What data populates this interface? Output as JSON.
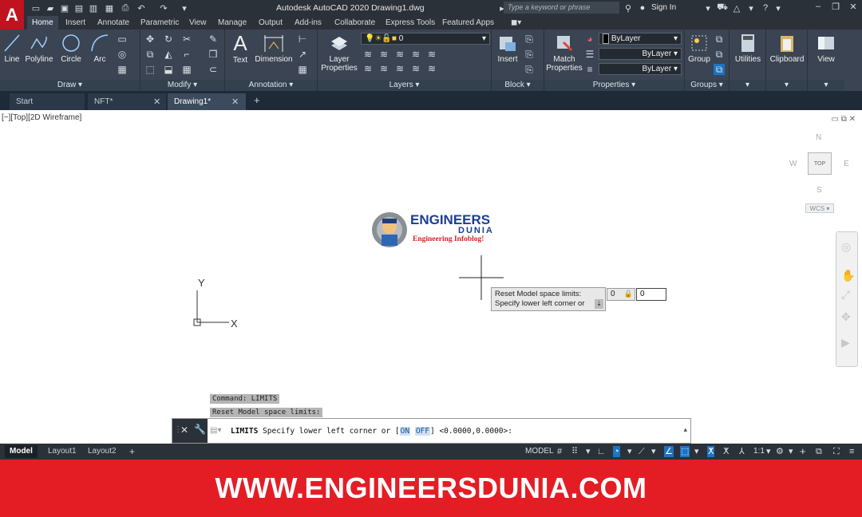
{
  "app": {
    "logo_letter": "A",
    "title": "Autodesk AutoCAD 2020    Drawing1.dwg",
    "search_placeholder": "Type a keyword or phrase",
    "sign_in": "Sign In"
  },
  "ribbon_tabs": [
    "Home",
    "Insert",
    "Annotate",
    "Parametric",
    "View",
    "Manage",
    "Output",
    "Add-ins",
    "Collaborate",
    "Express Tools",
    "Featured Apps"
  ],
  "ribbon": {
    "draw": {
      "title": "Draw",
      "line": "Line",
      "polyline": "Polyline",
      "circle": "Circle",
      "arc": "Arc"
    },
    "modify": {
      "title": "Modify"
    },
    "annotation": {
      "title": "Annotation",
      "text": "Text",
      "dimension": "Dimension"
    },
    "layers": {
      "title": "Layers",
      "layer_properties_1": "Layer",
      "layer_properties_2": "Properties",
      "current_layer": "0"
    },
    "block": {
      "title": "Block",
      "insert": "Insert"
    },
    "properties": {
      "title": "Properties",
      "match_1": "Match",
      "match_2": "Properties",
      "color": "ByLayer",
      "linetype": "ByLayer",
      "lineweight": "ByLayer"
    },
    "groups": {
      "title": "Groups",
      "group": "Group"
    },
    "utilities": "Utilities",
    "clipboard": "Clipboard",
    "view": "View"
  },
  "doc_tabs": {
    "start": "Start",
    "nft": "NFT*",
    "drawing": "Drawing1*"
  },
  "viewport": {
    "label": "[−][Top][2D Wireframe]",
    "cube_n": "N",
    "cube_s": "S",
    "cube_e": "E",
    "cube_w": "W",
    "cube_top": "TOP",
    "wcs": "WCS",
    "ucs_x": "X",
    "ucs_y": "Y"
  },
  "logo": {
    "line1": "ENGINEERS",
    "line2": "DUNIA",
    "tagline": "Engineering Infoblog!"
  },
  "prompt": {
    "line1": "Reset Model space limits:",
    "line2": "Specify lower left corner or",
    "input_x": "0",
    "input_y": "0"
  },
  "command_history": [
    "Command: LIMITS",
    "Reset Model space limits:"
  ],
  "command_line": {
    "keyword": "LIMITS",
    "text_a": " Specify lower left corner or [",
    "opt_on": "ON",
    "opt_off": "OFF",
    "text_b": "] <0.0000,0.0000>:"
  },
  "status": {
    "model_tab": "Model",
    "layout1": "Layout1",
    "layout2": "Layout2",
    "model_space": "MODEL",
    "scale": "1:1"
  },
  "banner": "WWW.ENGINEERSDUNIA.COM",
  "colors": {
    "banner_red": "#e41d25",
    "ribbon_bg": "#3b4453",
    "accent_blue": "#1a74c4",
    "autocad_red": "#c1121f"
  }
}
